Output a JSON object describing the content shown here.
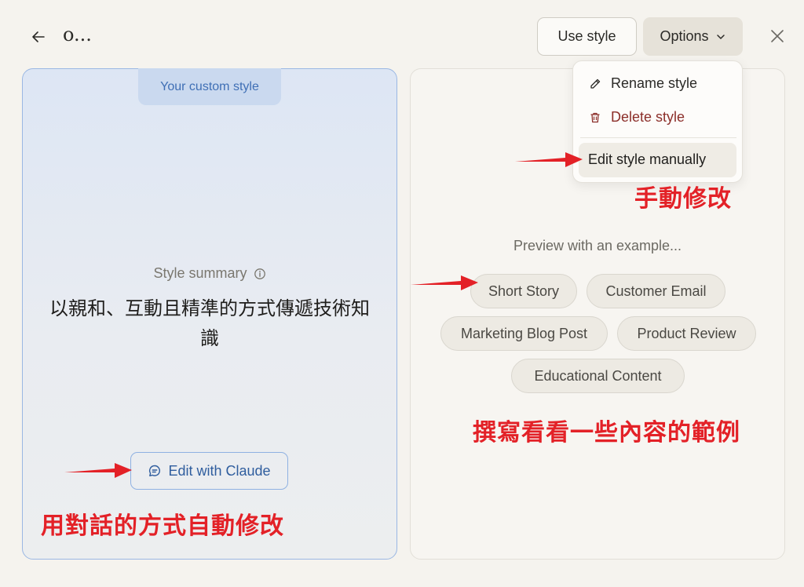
{
  "header": {
    "title": "o...",
    "use_style_label": "Use style",
    "options_label": "Options"
  },
  "left_panel": {
    "tag": "Your custom style",
    "summary_label": "Style summary",
    "summary_text": "以親和、互動且精準的方式傳遞技術知識",
    "edit_button": "Edit with Claude"
  },
  "options_menu": {
    "items": [
      {
        "label": "Rename style",
        "icon": "pencil-icon"
      },
      {
        "label": "Delete style",
        "icon": "trash-icon",
        "color": "#8c2f2a"
      },
      {
        "label": "Edit style manually",
        "highlighted": true
      }
    ]
  },
  "right_panel": {
    "preview_label": "Preview with an example...",
    "examples": [
      "Short Story",
      "Customer Email",
      "Marketing Blog Post",
      "Product Review",
      "Educational Content"
    ]
  },
  "annotations": {
    "manual": "手動修改",
    "examples": "撰寫看看一些內容的範例",
    "chat": "用對話的方式自動修改"
  },
  "colors": {
    "accent_blue": "#2f5d9e",
    "annotation_red": "#e32127",
    "delete_red": "#8c2f2a"
  }
}
